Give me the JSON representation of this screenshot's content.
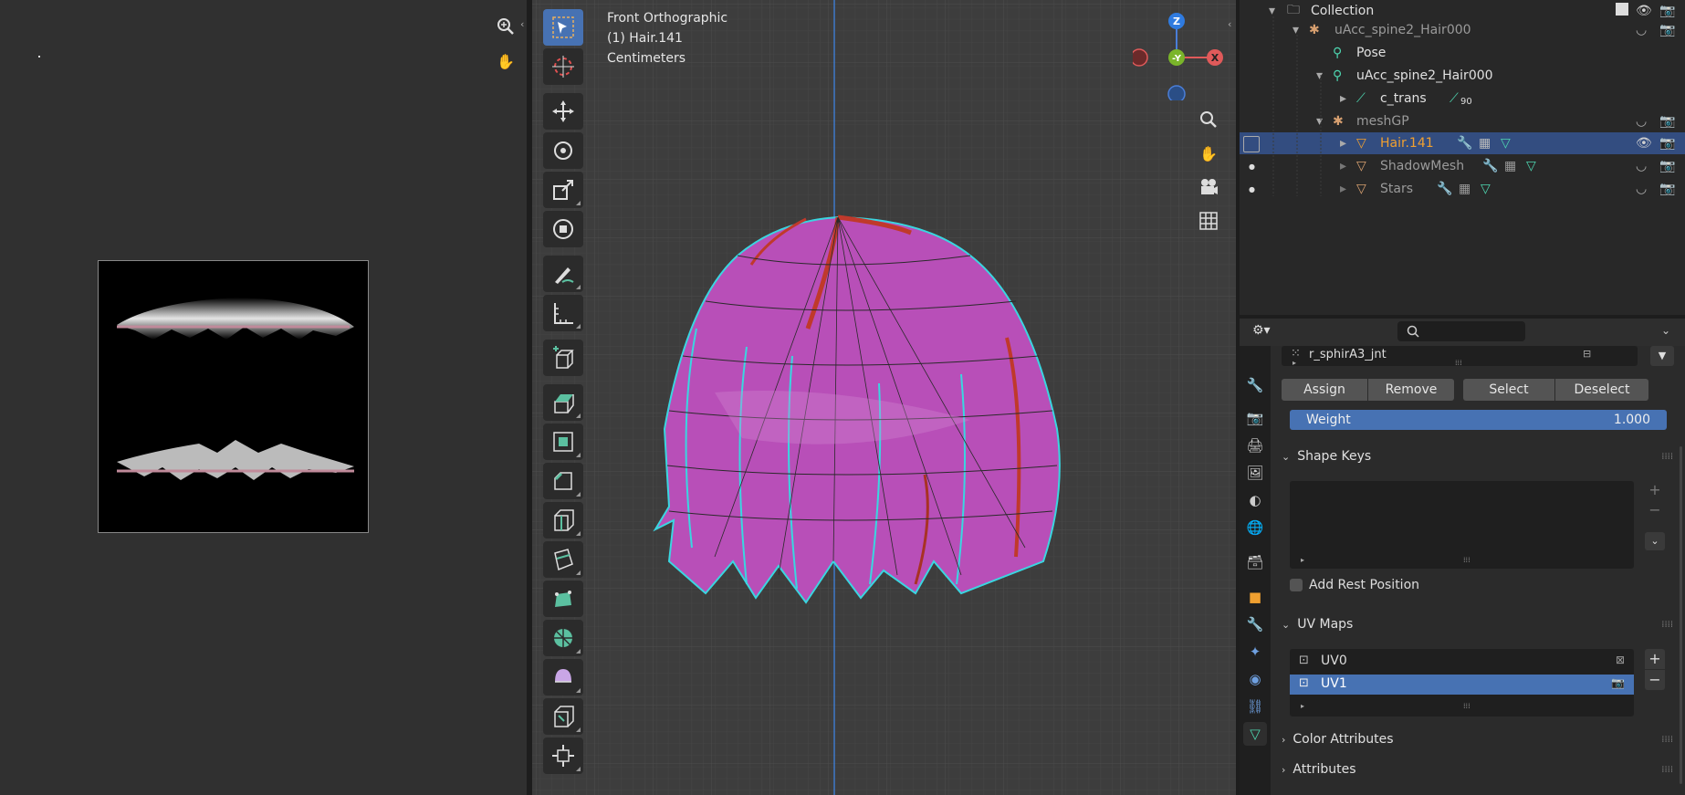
{
  "viewport": {
    "view_name": "Front Orthographic",
    "object_label": "(1) Hair.141",
    "units": "Centimeters",
    "gizmo": {
      "z": "Z",
      "y": "-Y",
      "x": "X"
    }
  },
  "outliner": {
    "rows": [
      {
        "label": "Collection"
      },
      {
        "label": "uAcc_spine2_Hair000"
      },
      {
        "label": "Pose"
      },
      {
        "label": "uAcc_spine2_Hair000"
      },
      {
        "label": "c_trans",
        "badge": "90"
      },
      {
        "label": "meshGP"
      },
      {
        "label": "Hair.141"
      },
      {
        "label": "ShadowMesh"
      },
      {
        "label": "Stars"
      }
    ]
  },
  "properties": {
    "vertex_group_item": "r_sphirA3_jnt",
    "buttons": {
      "assign": "Assign",
      "remove": "Remove",
      "select": "Select",
      "deselect": "Deselect"
    },
    "weight": {
      "label": "Weight",
      "value": "1.000"
    },
    "shape_keys": {
      "title": "Shape Keys"
    },
    "add_rest_position": "Add Rest Position",
    "uv_maps": {
      "title": "UV Maps",
      "items": [
        "UV0",
        "UV1"
      ]
    },
    "color_attributes": "Color Attributes",
    "attributes": "Attributes"
  },
  "colors": {
    "accent": "#4772b3",
    "selected_row": "#334d80",
    "active_object": "#f0a030",
    "mesh": "#b84fb8"
  }
}
